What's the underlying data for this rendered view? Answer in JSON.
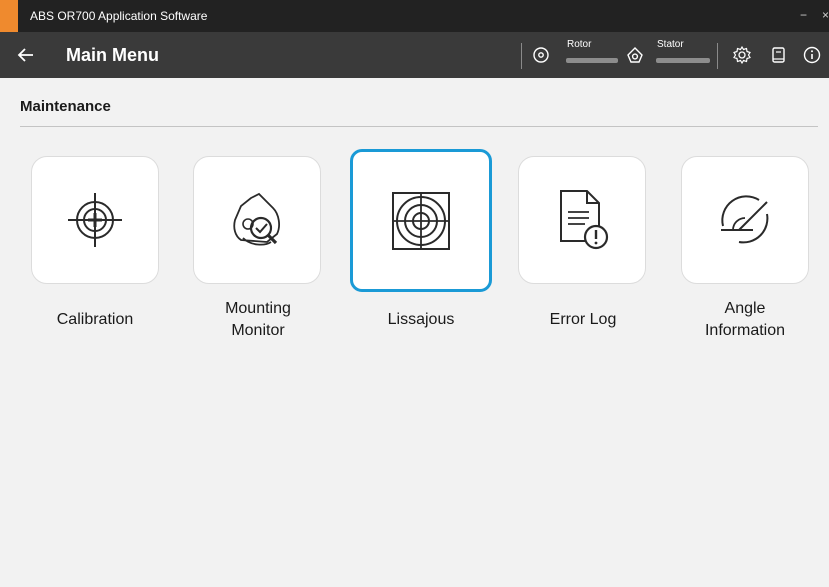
{
  "window": {
    "title": "ABS OR700 Application Software",
    "minimize": "−",
    "close": "×",
    "accent_color": "#ef8a2e"
  },
  "header": {
    "back_icon": "arrow-left-icon",
    "title": "Main Menu",
    "rotor_label": "Rotor",
    "stator_label": "Stator",
    "icons": [
      "rotor-icon",
      "stator-icon",
      "settings-icon",
      "manual-icon",
      "info-icon"
    ]
  },
  "section": {
    "title": "Maintenance"
  },
  "tiles": [
    {
      "label": "Calibration",
      "icon": "crosshair-plus-icon",
      "selected": false
    },
    {
      "label": "Mounting Monitor",
      "icon": "magnifier-check-icon",
      "selected": false
    },
    {
      "label": "Lissajous",
      "icon": "target-grid-icon",
      "selected": true
    },
    {
      "label": "Error Log",
      "icon": "document-alert-icon",
      "selected": false
    },
    {
      "label": "Angle Information",
      "icon": "angle-gauge-icon",
      "selected": false
    }
  ],
  "colors": {
    "selection": "#1a9ad6",
    "titlebar": "#222222",
    "header": "#3a3a3a",
    "background": "#f2f2f2"
  }
}
